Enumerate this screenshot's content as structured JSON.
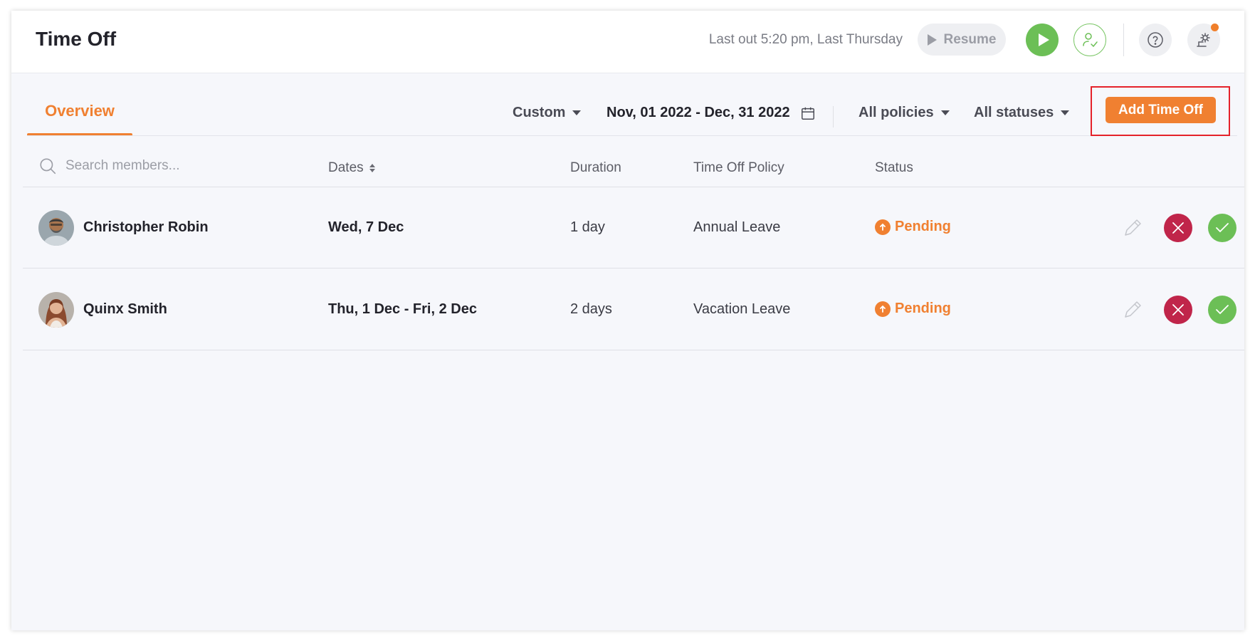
{
  "header": {
    "title": "Time Off",
    "last_out": "Last out 5:20 pm, Last Thursday",
    "resume_label": "Resume",
    "play_icon": "play-icon",
    "user_check_icon": "user-check-icon",
    "help_icon": "question-circle-icon",
    "settings_icon": "settings-gear-icon"
  },
  "toolbar": {
    "tab_overview": "Overview",
    "range_type": "Custom",
    "date_range": "Nov, 01 2022 - Dec, 31 2022",
    "policies_filter": "All policies",
    "statuses_filter": "All statuses",
    "add_button": "Add Time Off"
  },
  "table": {
    "search_placeholder": "Search members...",
    "columns": [
      "Dates",
      "Duration",
      "Time Off Policy",
      "Status"
    ],
    "rows": [
      {
        "name": "Christopher Robin",
        "dates": "Wed, 7 Dec",
        "duration": "1 day",
        "policy": "Annual Leave",
        "status": "Pending"
      },
      {
        "name": "Quinx Smith",
        "dates": "Thu, 1 Dec - Fri, 2 Dec",
        "duration": "2 days",
        "policy": "Vacation Leave",
        "status": "Pending"
      }
    ]
  },
  "colors": {
    "accent": "#f08031",
    "approve": "#6cbf56",
    "reject": "#c0254a",
    "highlight": "#e5222a"
  }
}
